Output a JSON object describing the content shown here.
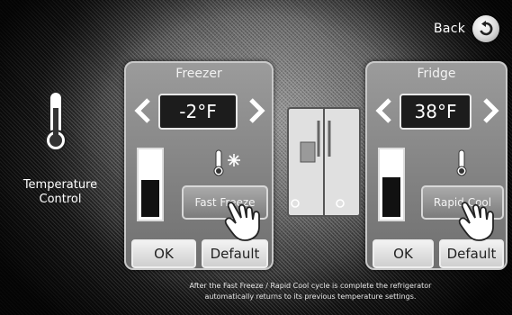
{
  "nav": {
    "back_label": "Back"
  },
  "left": {
    "title_line1": "Temperature",
    "title_line2": "Control"
  },
  "freezer": {
    "title": "Freezer",
    "temperature": "-2°F",
    "mode_button": "Fast Freeze",
    "ok_label": "OK",
    "default_label": "Default",
    "level": 0.55
  },
  "fridge": {
    "title": "Fridge",
    "temperature": "38°F",
    "mode_button": "Rapid Cool",
    "ok_label": "OK",
    "default_label": "Default",
    "level": 0.6
  },
  "footer": {
    "note_line1": "After the Fast Freeze / Rapid Cool cycle is complete the refrigerator",
    "note_line2": "automatically returns to its previous temperature settings."
  }
}
